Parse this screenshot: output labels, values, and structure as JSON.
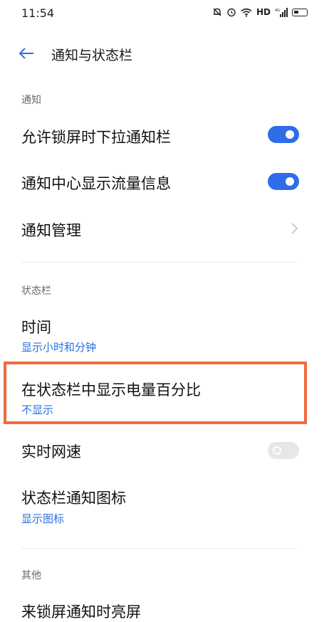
{
  "status_bar": {
    "time": "11:54",
    "network_label": "HD",
    "signal_label": "4G",
    "icons": [
      "mute-bell-icon",
      "alarm-icon",
      "wifi-icon",
      "hd-icon",
      "signal-icon",
      "battery-icon"
    ]
  },
  "header": {
    "title": "通知与状态栏",
    "back_icon": "arrow-left-icon"
  },
  "sections": {
    "notification": {
      "label": "通知",
      "items": [
        {
          "title": "允许锁屏时下拉通知栏",
          "control": "toggle",
          "on": true
        },
        {
          "title": "通知中心显示流量信息",
          "control": "toggle",
          "on": true
        },
        {
          "title": "通知管理",
          "control": "chevron"
        }
      ]
    },
    "status_bar": {
      "label": "状态栏",
      "items": [
        {
          "title": "时间",
          "subtitle": "显示小时和分钟"
        },
        {
          "title": "在状态栏中显示电量百分比",
          "subtitle": "不显示",
          "highlighted": true
        },
        {
          "title": "实时网速",
          "control": "toggle",
          "on": false
        },
        {
          "title": "状态栏通知图标",
          "subtitle": "显示图标"
        }
      ]
    },
    "other": {
      "label": "其他",
      "items": [
        {
          "title": "来锁屏通知时亮屏"
        }
      ]
    }
  },
  "colors": {
    "accent": "#2f6de8",
    "subtitle": "#2a6fe0",
    "highlight_border": "#ef6a3d",
    "toggle_off": "#e7e7e7"
  }
}
